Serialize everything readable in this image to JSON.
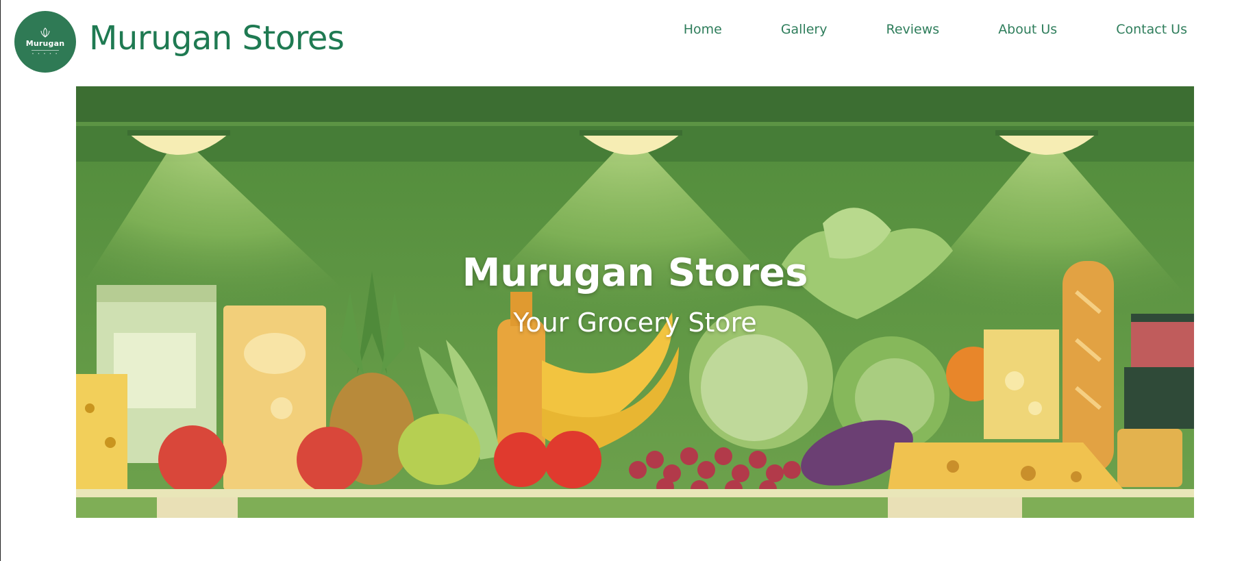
{
  "header": {
    "logo": {
      "text": "Murugan",
      "icon": "leaf-icon"
    },
    "brand_title": "Murugan Stores",
    "nav": [
      {
        "label": "Home"
      },
      {
        "label": "Gallery"
      },
      {
        "label": "Reviews"
      },
      {
        "label": "About Us"
      },
      {
        "label": "Contact Us"
      }
    ]
  },
  "hero": {
    "title": "Murugan Stores",
    "subtitle": "Your Grocery Store",
    "image": "grocery-shelf-illustration"
  },
  "colors": {
    "brand_green": "#1f7a52",
    "nav_green": "#2e7d5b",
    "logo_bg": "#2f7a55",
    "hero_bg": "#6fa04c",
    "page_bg": "#ffffff"
  }
}
